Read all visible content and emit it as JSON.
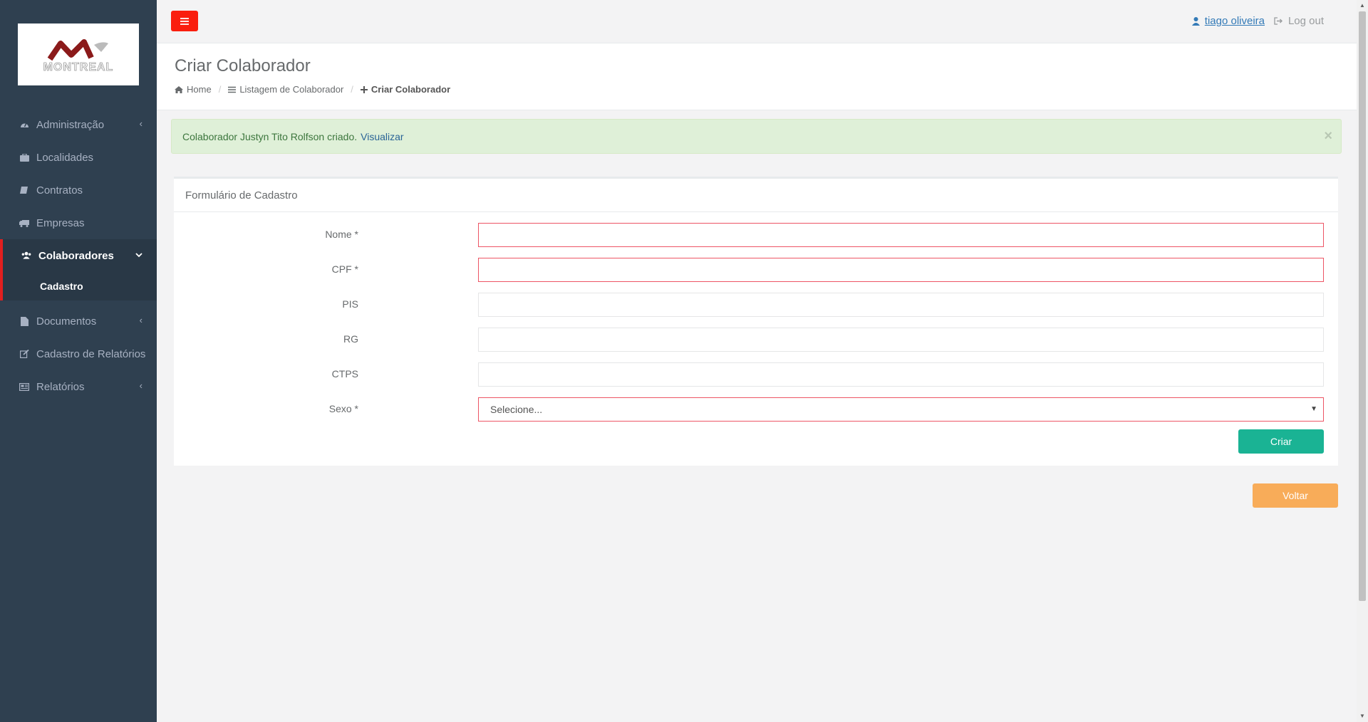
{
  "app": {
    "logo_text": "MONTREAL",
    "accent_color": "#e21f1f"
  },
  "sidebar": {
    "items": [
      {
        "label": "Administração",
        "icon": "dashboard-icon",
        "has_submenu": true
      },
      {
        "label": "Localidades",
        "icon": "suitcase-icon",
        "has_submenu": false
      },
      {
        "label": "Contratos",
        "icon": "book-icon",
        "has_submenu": false
      },
      {
        "label": "Empresas",
        "icon": "truck-icon",
        "has_submenu": false
      },
      {
        "label": "Colaboradores",
        "icon": "users-icon",
        "has_submenu": true,
        "expanded": true,
        "subitems": [
          {
            "label": "Cadastro"
          }
        ]
      },
      {
        "label": "Documentos",
        "icon": "file-icon",
        "has_submenu": true
      },
      {
        "label": "Cadastro de Relatórios",
        "icon": "edit-icon",
        "has_submenu": false
      },
      {
        "label": "Relatórios",
        "icon": "newspaper-icon",
        "has_submenu": true
      }
    ]
  },
  "topbar": {
    "user_name": "tiago oliveira",
    "logout_label": "Log out"
  },
  "heading": {
    "title": "Criar Colaborador",
    "breadcrumb": [
      "Home",
      "Listagem de Colaborador",
      "Criar Colaborador"
    ]
  },
  "alert": {
    "message": "Colaborador Justyn Tito Rolfson criado.",
    "link_text": "Visualizar",
    "close": "×"
  },
  "form": {
    "title": "Formulário de Cadastro",
    "fields": [
      {
        "label": "Nome *",
        "value": ""
      },
      {
        "label": "CPF *",
        "value": ""
      },
      {
        "label": "PIS",
        "value": ""
      },
      {
        "label": "RG",
        "value": ""
      },
      {
        "label": "CTPS",
        "value": ""
      },
      {
        "label": "Sexo *",
        "selected": "Selecione..."
      }
    ],
    "submit_label": "Criar"
  },
  "back_label": "Voltar"
}
